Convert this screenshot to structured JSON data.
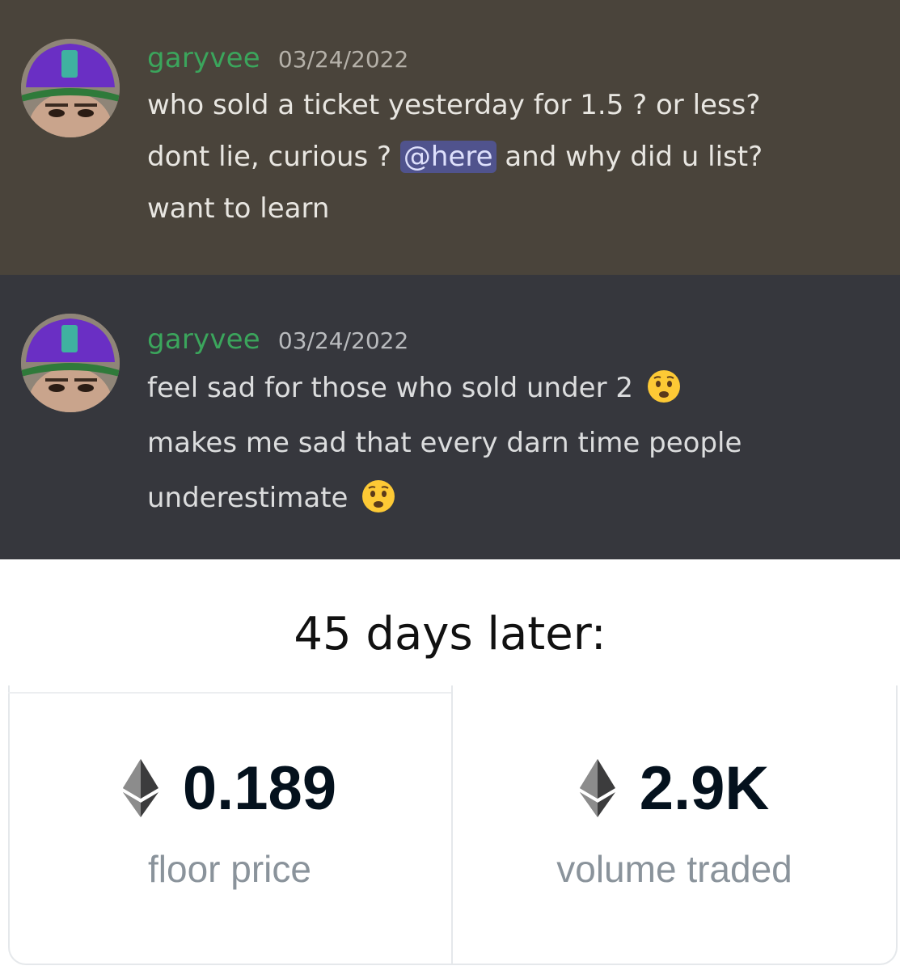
{
  "messages": [
    {
      "username": "garyvee",
      "timestamp": "03/24/2022",
      "line1": "who sold a ticket yesterday for 1.5 ? or less?",
      "line2_before": "dont lie, curious ? ",
      "mention": "@here",
      "line2_after": " and why did u list?",
      "line3": "want to learn"
    },
    {
      "username": "garyvee",
      "timestamp": "03/24/2022",
      "line1": "feel sad for those who sold under 2",
      "line2": "makes me sad that every darn time people",
      "line3": "underestimate"
    }
  ],
  "caption": "45 days later:",
  "stats": {
    "floor": {
      "value": "0.189",
      "label": "floor price"
    },
    "volume": {
      "value": "2.9K",
      "label": "volume traded"
    }
  },
  "colors": {
    "username": "#3ba55c",
    "mention_bg": "#5865f2",
    "msg1_bg": "#4a443b",
    "msg2_bg": "#36373d"
  },
  "icons": {
    "emoji": "frowning-face-icon",
    "currency": "ethereum-icon"
  }
}
